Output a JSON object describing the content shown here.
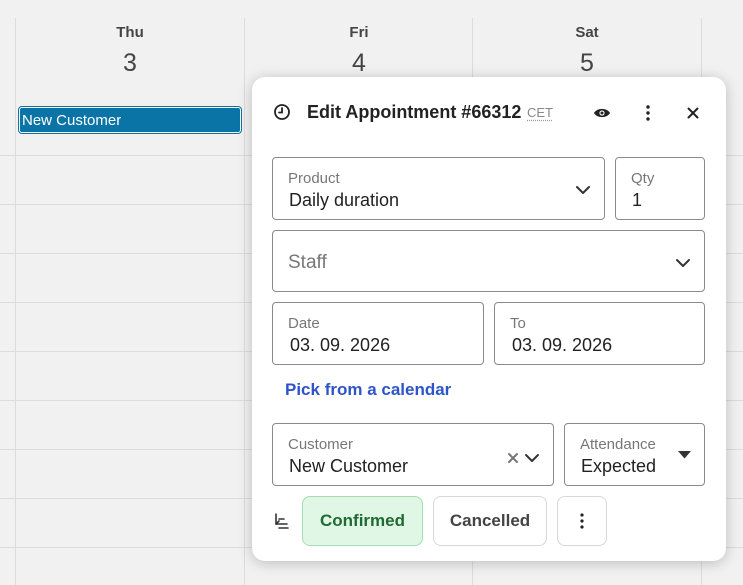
{
  "calendar": {
    "days": [
      {
        "name": "Thu",
        "number": "3"
      },
      {
        "name": "Fri",
        "number": "4"
      },
      {
        "name": "Sat",
        "number": "5"
      }
    ],
    "event": {
      "label": "New Customer",
      "color": "#0b74a6"
    }
  },
  "dialog": {
    "title": "Edit Appointment #66312",
    "timezone": "CET",
    "icons": {
      "clock": "clock-icon",
      "eye": "eye-icon",
      "more": "more-vertical-icon",
      "close": "close-icon"
    },
    "product": {
      "label": "Product",
      "value": "Daily duration"
    },
    "qty": {
      "label": "Qty",
      "value": "1"
    },
    "staff": {
      "placeholder": "Staff"
    },
    "date": {
      "label": "Date",
      "value": "03. 09. 2026"
    },
    "to": {
      "label": "To",
      "value": "03. 09. 2026"
    },
    "pick_link": "Pick from a calendar",
    "customer": {
      "label": "Customer",
      "value": "New Customer"
    },
    "attendance": {
      "label": "Attendance",
      "value": "Expected"
    },
    "status": {
      "confirmed_label": "Confirmed",
      "cancelled_label": "Cancelled",
      "selected": "Confirmed",
      "confirmed_color": "#dff7e4"
    },
    "accent_color": "#2e54c9"
  }
}
